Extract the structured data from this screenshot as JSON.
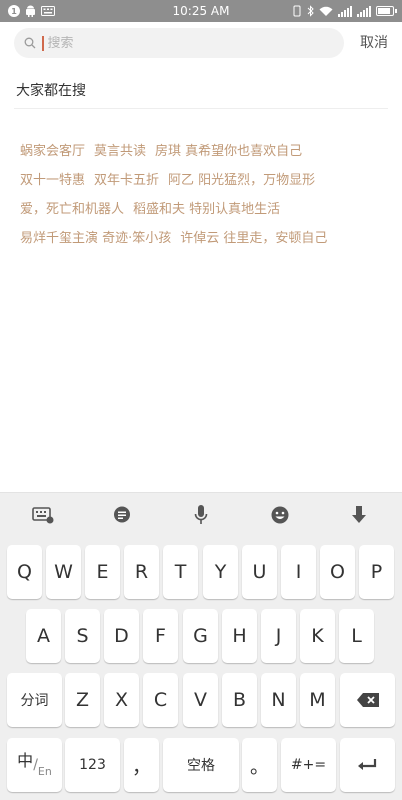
{
  "status_bar": {
    "badge": "1",
    "time": "10:25 AM",
    "battery_level": 0.85
  },
  "search": {
    "placeholder": "搜索",
    "cancel_label": "取消"
  },
  "trending": {
    "title": "大家都在搜",
    "rows": [
      [
        "蜗家会客厅",
        "莫言共读",
        "房琪 真希望你也喜欢自己"
      ],
      [
        "双十一特惠",
        "双年卡五折",
        "阿乙 阳光猛烈，万物显形"
      ],
      [
        "爱，死亡和机器人",
        "稻盛和夫 特别认真地生活"
      ],
      [
        "易烊千玺主演 奇迹·笨小孩",
        "许倬云 往里走，安顿自己"
      ]
    ]
  },
  "keyboard": {
    "toolbar": [
      "keyboard-icon",
      "chat-icon",
      "mic-icon",
      "emoji-icon",
      "hide-keyboard-icon"
    ],
    "row1": [
      "Q",
      "W",
      "E",
      "R",
      "T",
      "Y",
      "U",
      "I",
      "O",
      "P"
    ],
    "row2": [
      "A",
      "S",
      "D",
      "F",
      "G",
      "H",
      "J",
      "K",
      "L"
    ],
    "row3": [
      "Z",
      "X",
      "C",
      "V",
      "B",
      "N",
      "M"
    ],
    "segment_label": "分词",
    "lang_main": "中",
    "lang_sub": "En",
    "num_label": "123",
    "comma": "，",
    "space_label": "空格",
    "period": "。",
    "symbols_label": "#+="
  }
}
